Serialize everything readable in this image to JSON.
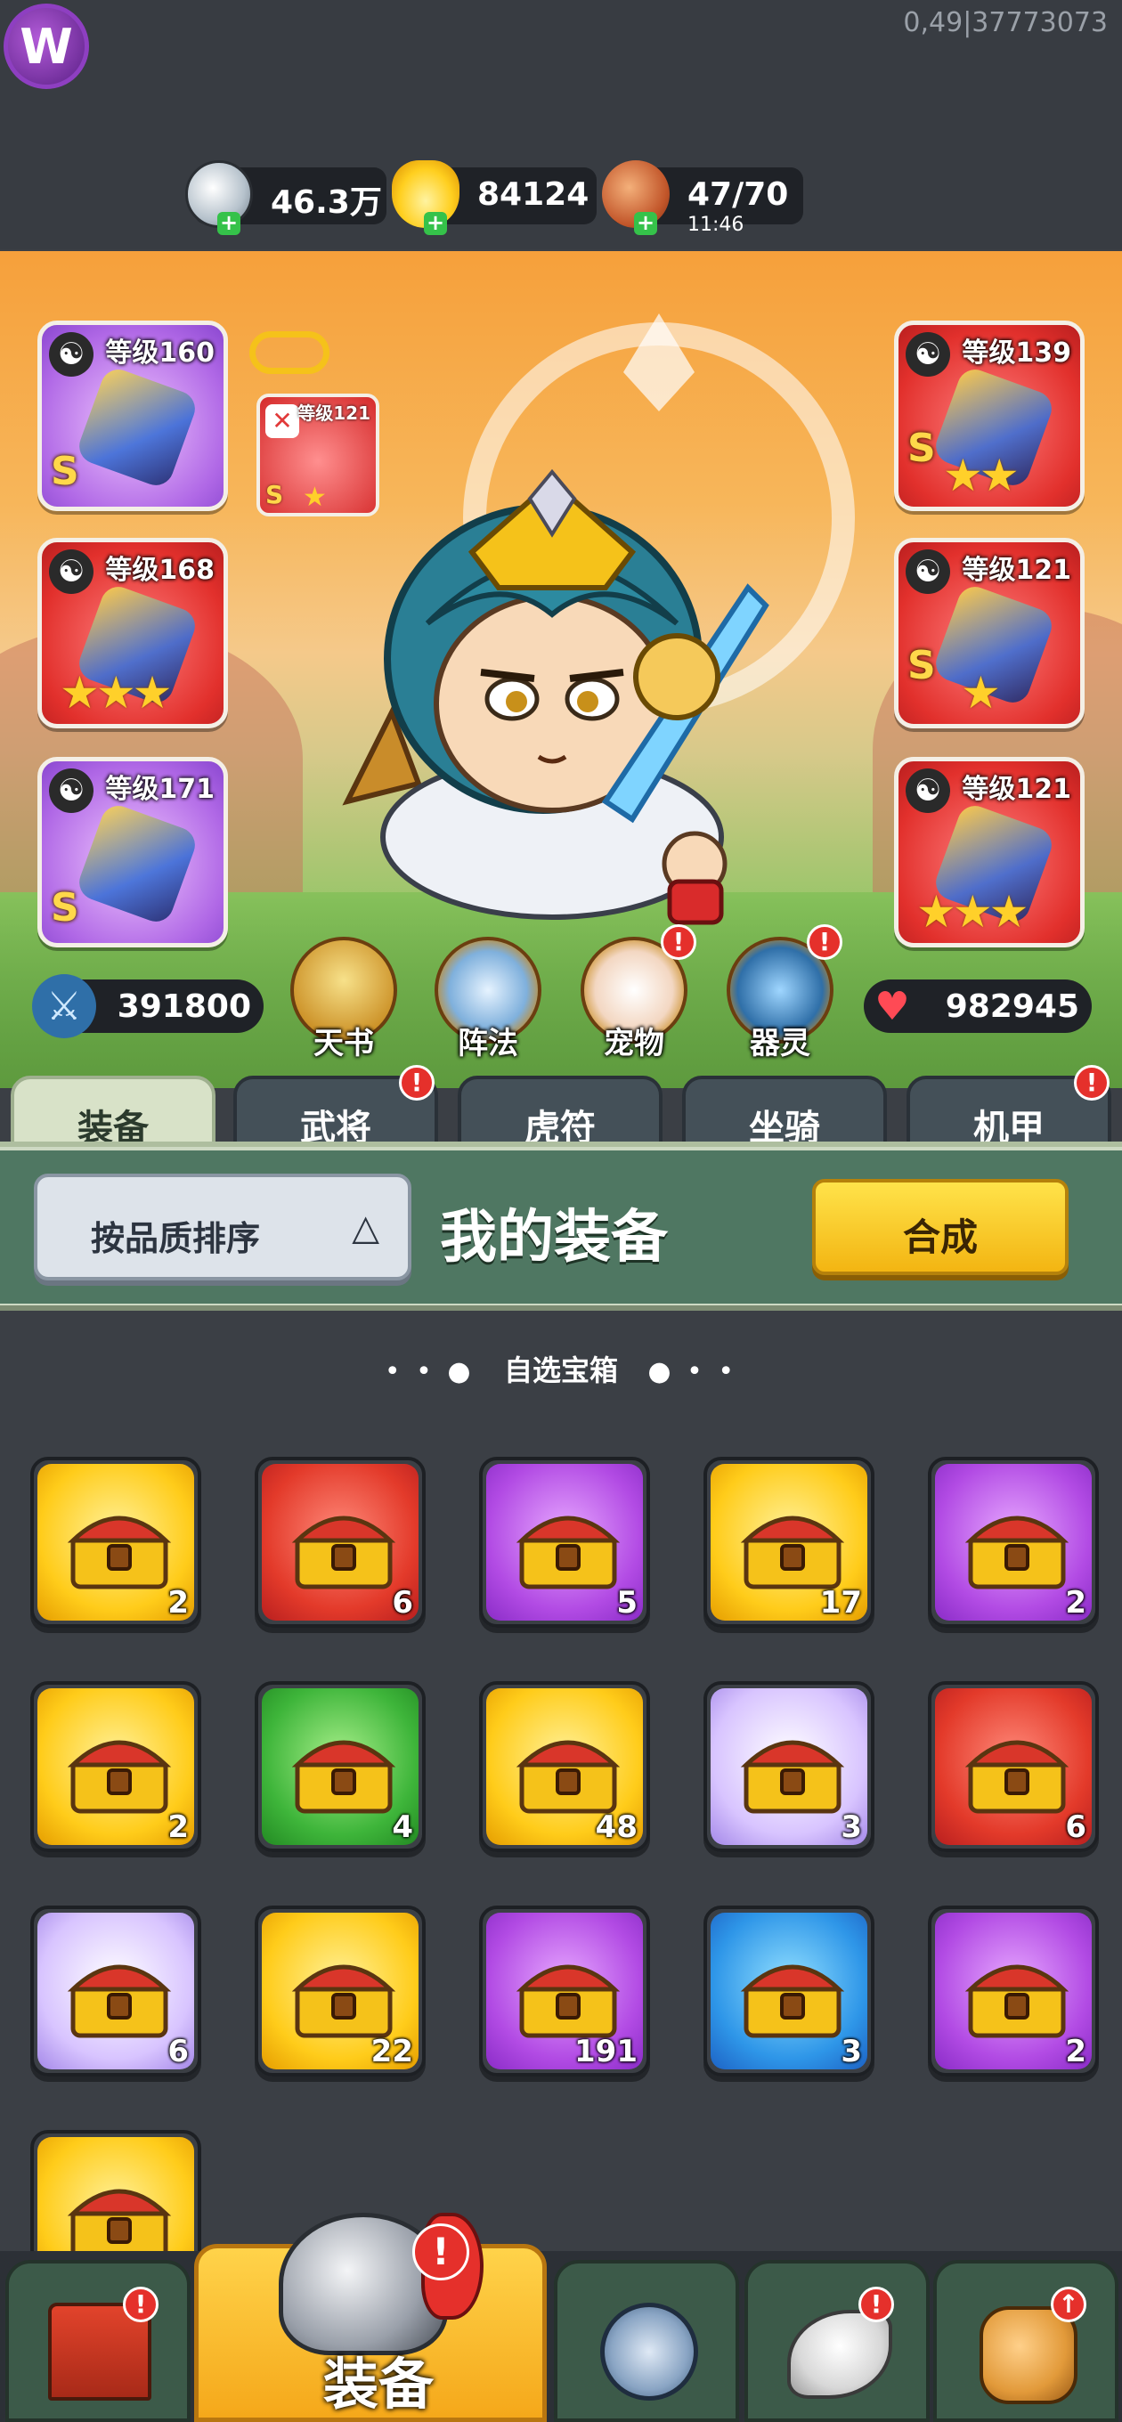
{
  "header": {
    "server_id": "0,49|37773073",
    "logo_letter": "W",
    "resources": {
      "silver": {
        "value": "46.3万",
        "icon": "silver-coin-icon"
      },
      "gold": {
        "value": "84124",
        "icon": "gold-ingot-icon"
      },
      "stamina": {
        "value": "47/70",
        "timer": "11:46",
        "icon": "meat-icon"
      }
    },
    "plus": "+"
  },
  "hero": {
    "slots_left": [
      {
        "level": "等级160",
        "grade": "S",
        "stars": "",
        "color": "purple"
      },
      {
        "level": "等级168",
        "grade": "",
        "stars": "★★★",
        "color": "red"
      },
      {
        "level": "等级171",
        "grade": "S",
        "stars": "",
        "color": "purple"
      }
    ],
    "slots_right": [
      {
        "level": "等级139",
        "grade": "S",
        "stars": "★★",
        "color": "red"
      },
      {
        "level": "等级121",
        "grade": "S",
        "stars": "★",
        "color": "red"
      },
      {
        "level": "等级121",
        "grade": "",
        "stars": "★★★",
        "color": "red"
      }
    ],
    "small_slot": {
      "level": "等级121",
      "grade": "S",
      "stars": "★"
    },
    "attack": "391800",
    "hp": "982945",
    "features": [
      {
        "label": "天书",
        "badge": false
      },
      {
        "label": "阵法",
        "badge": false
      },
      {
        "label": "宠物",
        "badge": true
      },
      {
        "label": "器灵",
        "badge": true
      }
    ],
    "yinyang": "☯",
    "badge_mark": "!"
  },
  "tabs": [
    {
      "label": "装备",
      "active": true,
      "badge": false
    },
    {
      "label": "武将",
      "active": false,
      "badge": true
    },
    {
      "label": "虎符",
      "active": false,
      "badge": false
    },
    {
      "label": "坐骑",
      "active": false,
      "badge": false
    },
    {
      "label": "机甲",
      "active": false,
      "badge": true
    }
  ],
  "panel": {
    "sort_label": "按品质排序",
    "sort_arrow": "△",
    "title": "我的装备",
    "craft_button": "合成"
  },
  "section": {
    "title": "自选宝箱",
    "dots_left": "• • ●",
    "dots_right": "● • •"
  },
  "items": [
    {
      "count": "2",
      "color": "gold"
    },
    {
      "count": "6",
      "color": "red"
    },
    {
      "count": "5",
      "color": "purple"
    },
    {
      "count": "17",
      "color": "gold"
    },
    {
      "count": "2",
      "color": "purple"
    },
    {
      "count": "2",
      "color": "gold"
    },
    {
      "count": "4",
      "color": "green"
    },
    {
      "count": "48",
      "color": "gold"
    },
    {
      "count": "3",
      "color": "lav"
    },
    {
      "count": "6",
      "color": "red"
    },
    {
      "count": "6",
      "color": "lav"
    },
    {
      "count": "22",
      "color": "gold"
    },
    {
      "count": "191",
      "color": "purple"
    },
    {
      "count": "3",
      "color": "blue"
    },
    {
      "count": "2",
      "color": "purple"
    },
    {
      "count": "",
      "color": "gold"
    }
  ],
  "bottom_nav": {
    "equipment_label": "装备",
    "items": [
      "shop-gate-icon",
      "helmet-icon",
      "swords-shield-icon",
      "wing-stars-icon",
      "fist-upgrade-icon"
    ]
  },
  "colors": {
    "accent_yellow": "#f3b512",
    "badge_red": "#e5302b",
    "panel_green": "#4f7762"
  }
}
